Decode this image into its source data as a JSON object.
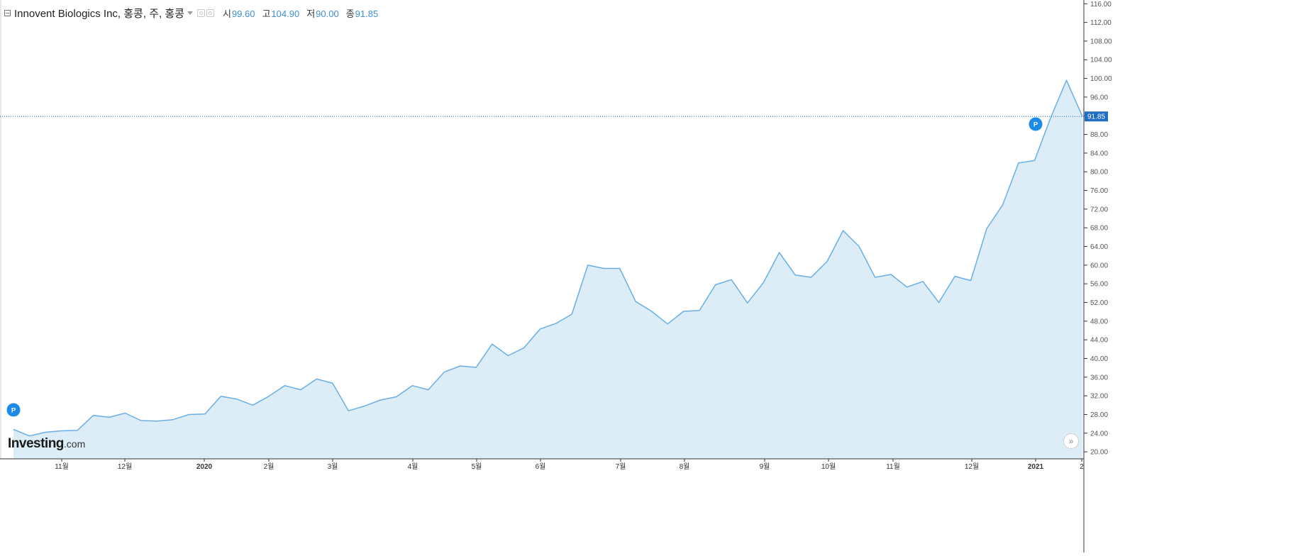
{
  "legend": {
    "title": "Innovent Biologics Inc, 홍콩, 주, 홍콩",
    "open_label": "시",
    "open_value": "99.60",
    "high_label": "고",
    "high_value": "104.90",
    "low_label": "저",
    "low_value": "90.00",
    "close_label": "종",
    "close_value": "91.85"
  },
  "brand": {
    "name": "Investing",
    "suffix": ".com"
  },
  "marker_label": "P",
  "colors": {
    "line": "#6aaee6",
    "fill": "#dcedf8",
    "price_tag": "#1f6ec4",
    "marker": "#1b8be8",
    "axis": "#555555"
  },
  "chart_data": {
    "type": "area",
    "title": "Innovent Biologics Inc, 홍콩, 주, 홍콩",
    "xlabel": "",
    "ylabel": "",
    "ylim": [
      18.5,
      116.8
    ],
    "yticks": [
      "116.00",
      "112.00",
      "108.00",
      "104.00",
      "100.00",
      "96.00",
      "92.00",
      "88.00",
      "84.00",
      "80.00",
      "76.00",
      "72.00",
      "68.00",
      "64.00",
      "60.00",
      "56.00",
      "52.00",
      "48.00",
      "44.00",
      "40.00",
      "36.00",
      "32.00",
      "28.00",
      "24.00",
      "20.00"
    ],
    "xtick_labels": [
      "11월",
      "12월",
      "2020",
      "2월",
      "3월",
      "4월",
      "5월",
      "6월",
      "7월",
      "8월",
      "9월",
      "10월",
      "11월",
      "12월",
      "2021",
      "2"
    ],
    "last_price": "91.85",
    "grid": false,
    "series": [
      {
        "values": [
          24.8,
          23.4,
          24.2,
          24.5,
          24.6,
          27.8,
          27.4,
          28.3,
          26.7,
          26.6,
          26.9,
          28.0,
          28.1,
          31.9,
          31.3,
          30.0,
          31.9,
          34.2,
          33.3,
          35.6,
          34.7,
          28.8,
          29.8,
          31.1,
          31.8,
          34.2,
          33.3,
          37.1,
          38.4,
          38.1,
          43.1,
          40.6,
          42.3,
          46.3,
          47.5,
          49.5,
          60.0,
          59.3,
          59.3,
          52.2,
          50.1,
          47.4,
          50.1,
          50.3,
          55.8,
          56.9,
          51.9,
          56.2,
          62.7,
          57.9,
          57.4,
          60.8,
          67.4,
          64.0,
          57.4,
          58.0,
          55.3,
          56.5,
          52.0,
          57.6,
          56.7,
          67.8,
          72.9,
          81.9,
          82.4,
          91.5,
          99.6,
          91.85
        ]
      }
    ],
    "markers": [
      {
        "index": 0,
        "label": "P"
      },
      {
        "index": 64,
        "label": "P"
      }
    ]
  }
}
